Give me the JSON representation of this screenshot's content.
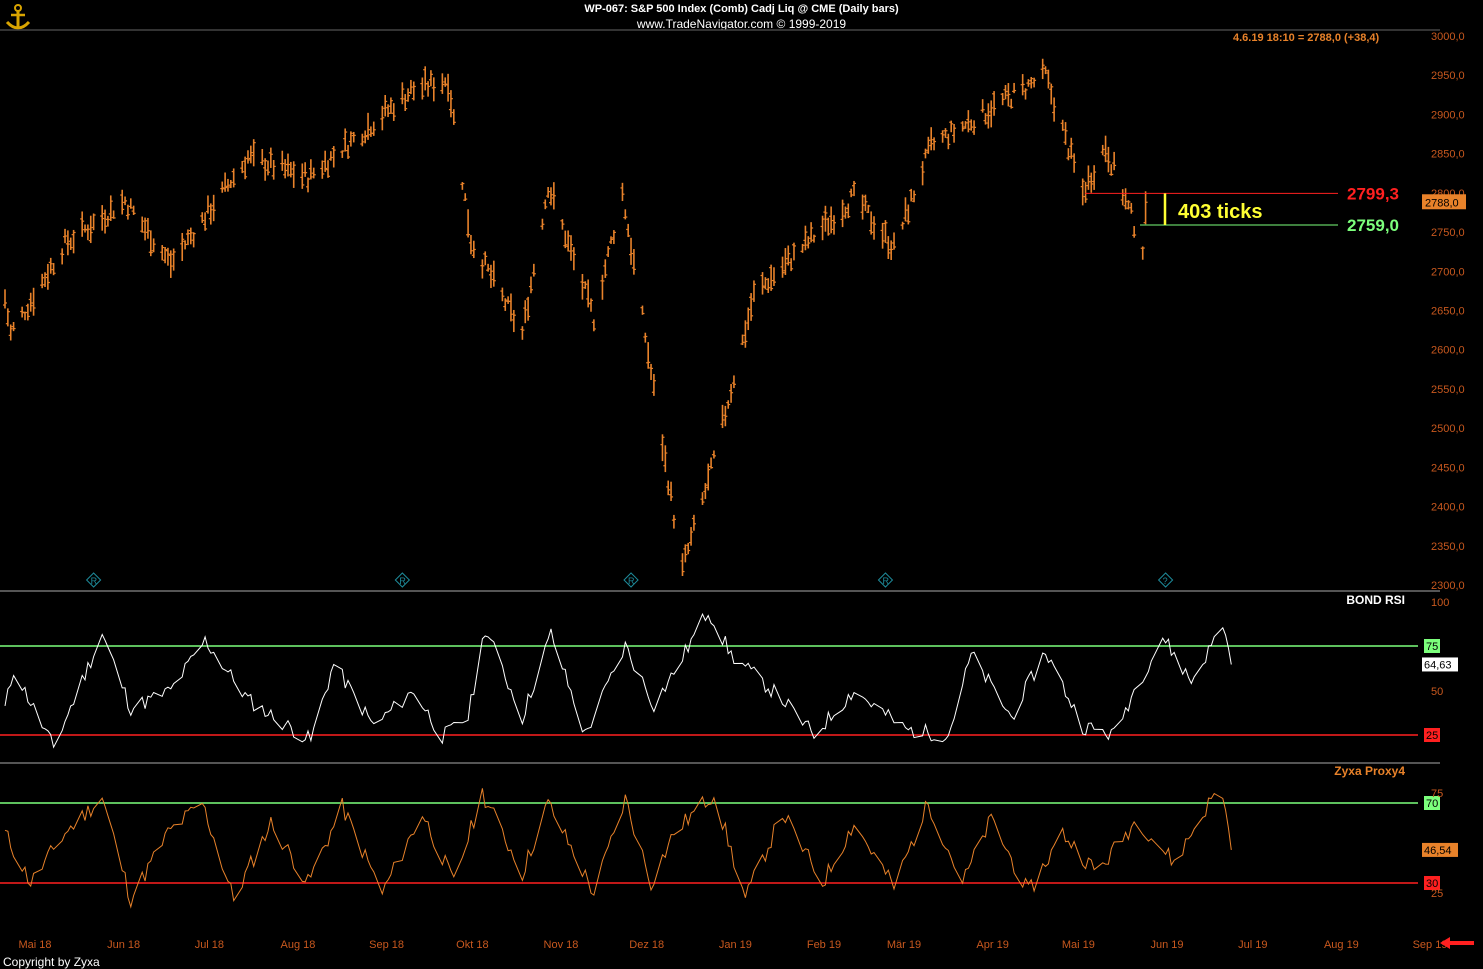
{
  "header": {
    "title": "WP-067:  S&P 500 Index (Comb) Cadj Liq @ CME  (Daily bars)",
    "subtitle": "www.TradeNavigator.com © 1999-2019"
  },
  "quote_line": "4.6.19 18:10 = 2788,0 (+38,4)",
  "copyright": "Copyright by Zyxa",
  "colors": {
    "background": "#000000",
    "price_bars": "#e8822a",
    "upper_band": "#7cff7c",
    "lower_band": "#ff2020",
    "axis_text": "#c8581e",
    "annotation": "#ffff33"
  },
  "chart_data": [
    {
      "type": "bar",
      "subtype": "ohlc",
      "title": "S&P 500 Index (Comb) Cadj Liq @ CME",
      "ylim": [
        2300,
        3000
      ],
      "y_ticks": [
        "3000,0",
        "2950,0",
        "2900,0",
        "2850,0",
        "2800,0",
        "2750,0",
        "2700,0",
        "2650,0",
        "2600,0",
        "2550,0",
        "2500,0",
        "2450,0",
        "2400,0",
        "2350,0",
        "2300,0"
      ],
      "x_ticks": [
        "Mai 18",
        "Jun 18",
        "Jul 18",
        "Aug 18",
        "Sep 18",
        "Okt 18",
        "Nov 18",
        "Dez 18",
        "Jan 19",
        "Feb 19",
        "Mär 19",
        "Apr 19",
        "Mai 19",
        "Jun 19",
        "Jul 19",
        "Aug 19",
        "Sep 19"
      ],
      "swing_points": [
        {
          "x": "2018-05-01",
          "y": 2665
        },
        {
          "x": "2018-05-03",
          "y": 2620
        },
        {
          "x": "2018-05-22",
          "y": 2735
        },
        {
          "x": "2018-06-12",
          "y": 2790
        },
        {
          "x": "2018-06-28",
          "y": 2710
        },
        {
          "x": "2018-07-25",
          "y": 2845
        },
        {
          "x": "2018-08-15",
          "y": 2820
        },
        {
          "x": "2018-09-20",
          "y": 2930
        },
        {
          "x": "2018-10-03",
          "y": 2945
        },
        {
          "x": "2018-10-11",
          "y": 2740
        },
        {
          "x": "2018-10-29",
          "y": 2620
        },
        {
          "x": "2018-11-07",
          "y": 2810
        },
        {
          "x": "2018-11-23",
          "y": 2640
        },
        {
          "x": "2018-12-03",
          "y": 2800
        },
        {
          "x": "2018-12-24",
          "y": 2320
        },
        {
          "x": "2019-01-03",
          "y": 2445
        },
        {
          "x": "2019-01-18",
          "y": 2670
        },
        {
          "x": "2019-02-22",
          "y": 2795
        },
        {
          "x": "2019-03-08",
          "y": 2730
        },
        {
          "x": "2019-03-21",
          "y": 2860
        },
        {
          "x": "2019-04-30",
          "y": 2950
        },
        {
          "x": "2019-05-13",
          "y": 2800
        },
        {
          "x": "2019-05-21",
          "y": 2860
        },
        {
          "x": "2019-06-03",
          "y": 2730
        },
        {
          "x": "2019-06-04",
          "y": 2788
        }
      ],
      "last": 2788.0,
      "last_label": "2788,0",
      "levels": [
        {
          "value": 2799.3,
          "label": "2799,3",
          "color": "#ff2020"
        },
        {
          "value": 2759.0,
          "label": "2759,0",
          "color": "#7cff7c"
        }
      ],
      "annotation": "403 ticks",
      "markers": [
        {
          "date": "2018-06-01",
          "glyph": "R"
        },
        {
          "date": "2018-09-17",
          "glyph": "R"
        },
        {
          "date": "2018-12-06",
          "glyph": "R"
        },
        {
          "date": "2019-03-05",
          "glyph": "R"
        },
        {
          "date": "2019-06-11",
          "glyph": "?"
        }
      ]
    },
    {
      "type": "line",
      "title": "BOND RSI",
      "ylim": [
        0,
        100
      ],
      "y_ticks": [
        "100",
        "50"
      ],
      "bands": [
        {
          "value": 75,
          "label": "75",
          "color": "#7cff7c"
        },
        {
          "value": 25,
          "label": "25",
          "color": "#ff2020"
        }
      ],
      "last": 64.63,
      "last_label": "64,63",
      "swing_points": [
        {
          "x": "2018-05-01",
          "y": 40
        },
        {
          "x": "2018-05-04",
          "y": 62
        },
        {
          "x": "2018-05-18",
          "y": 18
        },
        {
          "x": "2018-06-04",
          "y": 82
        },
        {
          "x": "2018-06-14",
          "y": 40
        },
        {
          "x": "2018-06-28",
          "y": 50
        },
        {
          "x": "2018-07-10",
          "y": 78
        },
        {
          "x": "2018-07-25",
          "y": 45
        },
        {
          "x": "2018-08-03",
          "y": 35
        },
        {
          "x": "2018-08-16",
          "y": 22
        },
        {
          "x": "2018-08-24",
          "y": 65
        },
        {
          "x": "2018-09-07",
          "y": 30
        },
        {
          "x": "2018-09-21",
          "y": 50
        },
        {
          "x": "2018-10-01",
          "y": 24
        },
        {
          "x": "2018-10-10",
          "y": 35
        },
        {
          "x": "2018-10-16",
          "y": 85
        },
        {
          "x": "2018-10-29",
          "y": 35
        },
        {
          "x": "2018-11-08",
          "y": 82
        },
        {
          "x": "2018-11-20",
          "y": 25
        },
        {
          "x": "2018-12-04",
          "y": 75
        },
        {
          "x": "2018-12-14",
          "y": 42
        },
        {
          "x": "2018-12-21",
          "y": 60
        },
        {
          "x": "2019-01-02",
          "y": 95
        },
        {
          "x": "2019-01-10",
          "y": 70
        },
        {
          "x": "2019-01-28",
          "y": 45
        },
        {
          "x": "2019-02-08",
          "y": 25
        },
        {
          "x": "2019-02-22",
          "y": 50
        },
        {
          "x": "2019-03-12",
          "y": 28
        },
        {
          "x": "2019-03-27",
          "y": 25
        },
        {
          "x": "2019-04-04",
          "y": 70
        },
        {
          "x": "2019-04-18",
          "y": 35
        },
        {
          "x": "2019-04-30",
          "y": 72
        },
        {
          "x": "2019-05-13",
          "y": 30
        },
        {
          "x": "2019-05-24",
          "y": 25
        },
        {
          "x": "2019-05-31",
          "y": 50
        },
        {
          "x": "2019-06-10",
          "y": 80
        },
        {
          "x": "2019-06-20",
          "y": 55
        },
        {
          "x": "2019-06-27",
          "y": 75
        },
        {
          "x": "2019-07-01",
          "y": 88
        },
        {
          "x": "2019-07-04",
          "y": 64.63
        }
      ]
    },
    {
      "type": "line",
      "title": "Zyxa Proxy4",
      "ylim": [
        20,
        80
      ],
      "y_ticks": [
        "75",
        "25"
      ],
      "bands": [
        {
          "value": 70,
          "label": "70",
          "color": "#7cff7c"
        },
        {
          "value": 30,
          "label": "30",
          "color": "#ff2020"
        }
      ],
      "last": 46.54,
      "last_label": "46,54",
      "swing_points": [
        {
          "x": "2018-05-01",
          "y": 55
        },
        {
          "x": "2018-05-10",
          "y": 30
        },
        {
          "x": "2018-05-22",
          "y": 55
        },
        {
          "x": "2018-06-04",
          "y": 73
        },
        {
          "x": "2018-06-14",
          "y": 22
        },
        {
          "x": "2018-06-27",
          "y": 55
        },
        {
          "x": "2018-07-09",
          "y": 70
        },
        {
          "x": "2018-07-20",
          "y": 22
        },
        {
          "x": "2018-08-02",
          "y": 60
        },
        {
          "x": "2018-08-15",
          "y": 30
        },
        {
          "x": "2018-08-27",
          "y": 68
        },
        {
          "x": "2018-09-10",
          "y": 25
        },
        {
          "x": "2018-09-24",
          "y": 65
        },
        {
          "x": "2018-10-05",
          "y": 30
        },
        {
          "x": "2018-10-15",
          "y": 75
        },
        {
          "x": "2018-10-29",
          "y": 35
        },
        {
          "x": "2018-11-07",
          "y": 70
        },
        {
          "x": "2018-11-23",
          "y": 25
        },
        {
          "x": "2018-12-04",
          "y": 72
        },
        {
          "x": "2018-12-13",
          "y": 30
        },
        {
          "x": "2018-12-21",
          "y": 55
        },
        {
          "x": "2019-01-04",
          "y": 75
        },
        {
          "x": "2019-01-15",
          "y": 22
        },
        {
          "x": "2019-01-28",
          "y": 65
        },
        {
          "x": "2019-02-11",
          "y": 30
        },
        {
          "x": "2019-02-22",
          "y": 60
        },
        {
          "x": "2019-03-08",
          "y": 28
        },
        {
          "x": "2019-03-20",
          "y": 70
        },
        {
          "x": "2019-04-01",
          "y": 30
        },
        {
          "x": "2019-04-11",
          "y": 62
        },
        {
          "x": "2019-04-24",
          "y": 25
        },
        {
          "x": "2019-05-06",
          "y": 55
        },
        {
          "x": "2019-05-18",
          "y": 35
        },
        {
          "x": "2019-06-01",
          "y": 62
        },
        {
          "x": "2019-06-14",
          "y": 40
        },
        {
          "x": "2019-06-27",
          "y": 72
        },
        {
          "x": "2019-07-01",
          "y": 75
        },
        {
          "x": "2019-07-04",
          "y": 46.54
        }
      ]
    }
  ]
}
